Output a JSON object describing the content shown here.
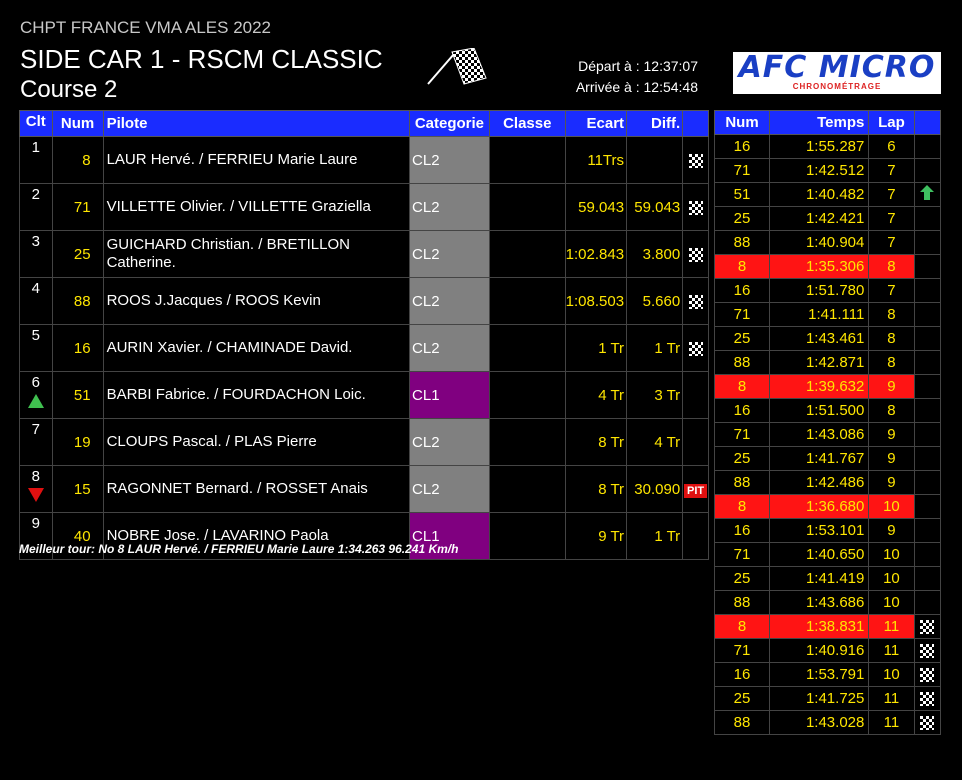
{
  "header": {
    "event": "CHPT FRANCE VMA ALES 2022",
    "title": "SIDE CAR 1 - RSCM CLASSIC",
    "subtitle": "Course 2",
    "depart": "Départ à : 12:37:07",
    "arrivee": "Arrivée à : 12:54:48",
    "logo_brand": "AFC MICRO",
    "logo_sub": "CHRONOMÉTRAGE"
  },
  "main_table": {
    "headers": [
      "Clt",
      "Num",
      "Pilote",
      "Categorie",
      "Classe",
      "Ecart",
      "Diff.",
      ""
    ],
    "rows": [
      {
        "clt": "1",
        "num": "8",
        "pilote": "LAUR Hervé. / FERRIEU Marie Laure",
        "cat": "CL2",
        "classe": "",
        "ecart": "11Trs",
        "diff": "",
        "flag": "checkered",
        "arrow": "",
        "cat_color": "#808080"
      },
      {
        "clt": "2",
        "num": "71",
        "pilote": "VILLETTE Olivier. / VILLETTE Graziella",
        "cat": "CL2",
        "classe": "",
        "ecart": "59.043",
        "diff": "59.043",
        "flag": "checkered",
        "arrow": "",
        "cat_color": "#808080"
      },
      {
        "clt": "3",
        "num": "25",
        "pilote": "GUICHARD Christian. / BRETILLON Catherine.",
        "cat": "CL2",
        "classe": "",
        "ecart": "1:02.843",
        "diff": "3.800",
        "flag": "checkered",
        "arrow": "",
        "cat_color": "#808080"
      },
      {
        "clt": "4",
        "num": "88",
        "pilote": "ROOS J.Jacques / ROOS Kevin",
        "cat": "CL2",
        "classe": "",
        "ecart": "1:08.503",
        "diff": "5.660",
        "flag": "checkered",
        "arrow": "",
        "cat_color": "#808080"
      },
      {
        "clt": "5",
        "num": "16",
        "pilote": "AURIN Xavier. / CHAMINADE David.",
        "cat": "CL2",
        "classe": "",
        "ecart": "1 Tr",
        "diff": "1 Tr",
        "flag": "checkered",
        "arrow": "",
        "cat_color": "#808080"
      },
      {
        "clt": "6",
        "num": "51",
        "pilote": "BARBI Fabrice. / FOURDACHON Loic.",
        "cat": "CL1",
        "classe": "",
        "ecart": "4 Tr",
        "diff": "3 Tr",
        "flag": "",
        "arrow": "up",
        "cat_color": "#800080"
      },
      {
        "clt": "7",
        "num": "19",
        "pilote": "CLOUPS Pascal. / PLAS Pierre",
        "cat": "CL2",
        "classe": "",
        "ecart": "8 Tr",
        "diff": "4 Tr",
        "flag": "",
        "arrow": "",
        "cat_color": "#808080"
      },
      {
        "clt": "8",
        "num": "15",
        "pilote": "RAGONNET Bernard. / ROSSET Anais",
        "cat": "CL2",
        "classe": "",
        "ecart": "8 Tr",
        "diff": "30.090",
        "flag": "pit",
        "arrow": "down",
        "cat_color": "#808080"
      },
      {
        "clt": "9",
        "num": "40",
        "pilote": "NOBRE Jose. / LAVARINO Paola",
        "cat": "CL1",
        "classe": "",
        "ecart": "9 Tr",
        "diff": "1 Tr",
        "flag": "",
        "arrow": "",
        "cat_color": "#800080"
      }
    ],
    "pit_label": "PIT"
  },
  "footer": {
    "best_lap": "Meilleur tour: No 8 LAUR Hervé. / FERRIEU Marie Laure 1:34.263 96.241 Km/h"
  },
  "laps_table": {
    "headers": [
      "Num",
      "Temps",
      "Lap",
      ""
    ],
    "rows": [
      {
        "num": "16",
        "time": "1:55.287",
        "lap": "6",
        "style": "",
        "icon": ""
      },
      {
        "num": "71",
        "time": "1:42.512",
        "lap": "7",
        "style": "",
        "icon": ""
      },
      {
        "num": "51",
        "time": "1:40.482",
        "lap": "7",
        "style": "best",
        "icon": "up"
      },
      {
        "num": "25",
        "time": "1:42.421",
        "lap": "7",
        "style": "",
        "icon": ""
      },
      {
        "num": "88",
        "time": "1:40.904",
        "lap": "7",
        "style": "",
        "icon": ""
      },
      {
        "num": "8",
        "time": "1:35.306",
        "lap": "8",
        "style": "leader",
        "icon": ""
      },
      {
        "num": "16",
        "time": "1:51.780",
        "lap": "7",
        "style": "",
        "icon": ""
      },
      {
        "num": "71",
        "time": "1:41.111",
        "lap": "8",
        "style": "",
        "icon": ""
      },
      {
        "num": "25",
        "time": "1:43.461",
        "lap": "8",
        "style": "",
        "icon": ""
      },
      {
        "num": "88",
        "time": "1:42.871",
        "lap": "8",
        "style": "",
        "icon": ""
      },
      {
        "num": "8",
        "time": "1:39.632",
        "lap": "9",
        "style": "leader",
        "icon": ""
      },
      {
        "num": "16",
        "time": "1:51.500",
        "lap": "8",
        "style": "",
        "icon": ""
      },
      {
        "num": "71",
        "time": "1:43.086",
        "lap": "9",
        "style": "",
        "icon": ""
      },
      {
        "num": "25",
        "time": "1:41.767",
        "lap": "9",
        "style": "",
        "icon": ""
      },
      {
        "num": "88",
        "time": "1:42.486",
        "lap": "9",
        "style": "",
        "icon": ""
      },
      {
        "num": "8",
        "time": "1:36.680",
        "lap": "10",
        "style": "leader",
        "icon": ""
      },
      {
        "num": "16",
        "time": "1:53.101",
        "lap": "9",
        "style": "",
        "icon": ""
      },
      {
        "num": "71",
        "time": "1:40.650",
        "lap": "10",
        "style": "",
        "icon": ""
      },
      {
        "num": "25",
        "time": "1:41.419",
        "lap": "10",
        "style": "",
        "icon": ""
      },
      {
        "num": "88",
        "time": "1:43.686",
        "lap": "10",
        "style": "",
        "icon": ""
      },
      {
        "num": "8",
        "time": "1:38.831",
        "lap": "11",
        "style": "leader",
        "icon": "checkered"
      },
      {
        "num": "71",
        "time": "1:40.916",
        "lap": "11",
        "style": "",
        "icon": "checkered"
      },
      {
        "num": "16",
        "time": "1:53.791",
        "lap": "10",
        "style": "",
        "icon": "checkered"
      },
      {
        "num": "25",
        "time": "1:41.725",
        "lap": "11",
        "style": "",
        "icon": "checkered"
      },
      {
        "num": "88",
        "time": "1:43.028",
        "lap": "11",
        "style": "",
        "icon": "checkered"
      }
    ]
  },
  "colors": {
    "header_bg": "#1a2cff",
    "value_yellow": "#ffe600",
    "leader_red": "#ff1414",
    "best_green": "#90ff90",
    "cl1_purple": "#800080",
    "cl2_gray": "#808080"
  }
}
